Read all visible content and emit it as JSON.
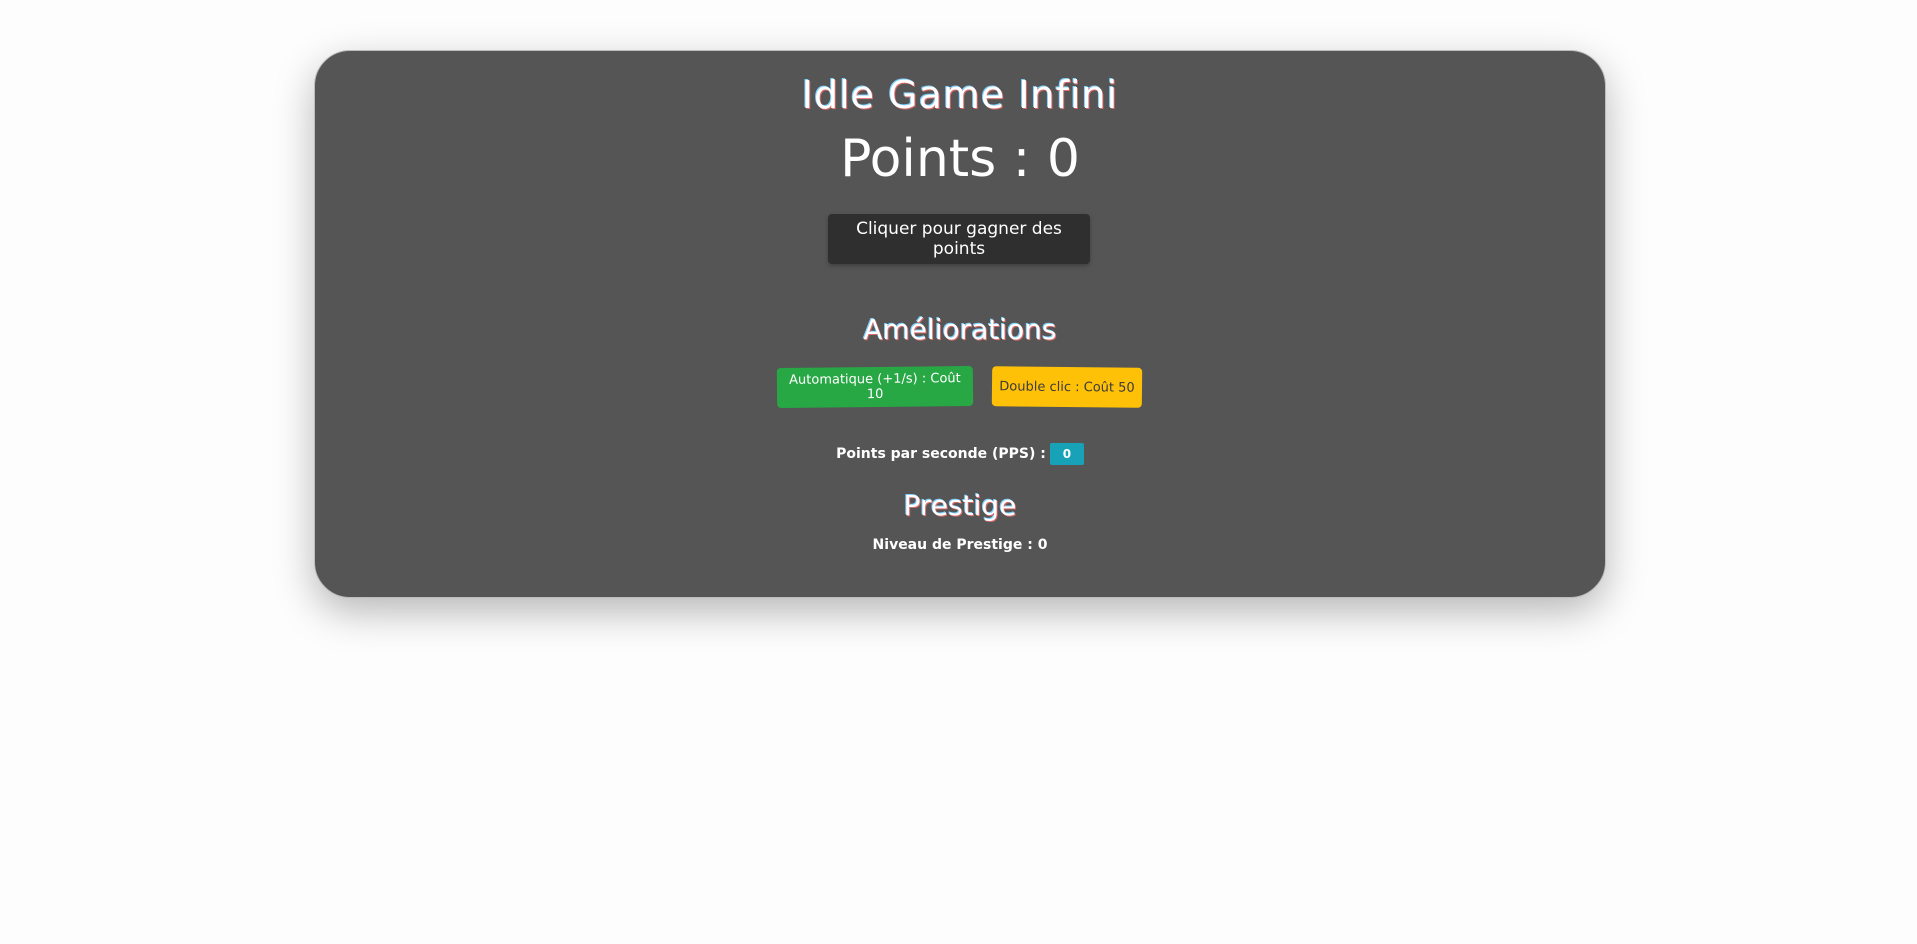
{
  "app": {
    "title": "Idle Game Infini",
    "points_label": "Points : 0"
  },
  "click_button": {
    "label": "Cliquer pour gagner des points"
  },
  "upgrades": {
    "title": "Améliorations",
    "auto_label": "Automatique (+1/s) : Coût 10",
    "double_label": "Double clic : Coût 50"
  },
  "pps": {
    "label": "Points par seconde (PPS) :",
    "value": "0"
  },
  "prestige": {
    "title": "Prestige",
    "level_label": "Niveau de Prestige : 0"
  },
  "colors": {
    "panel": "#555555",
    "click_button": "#2f2f2f",
    "upgrade_auto": "#28a745",
    "upgrade_double": "#ffc107",
    "pps_badge": "#17a2b8"
  }
}
